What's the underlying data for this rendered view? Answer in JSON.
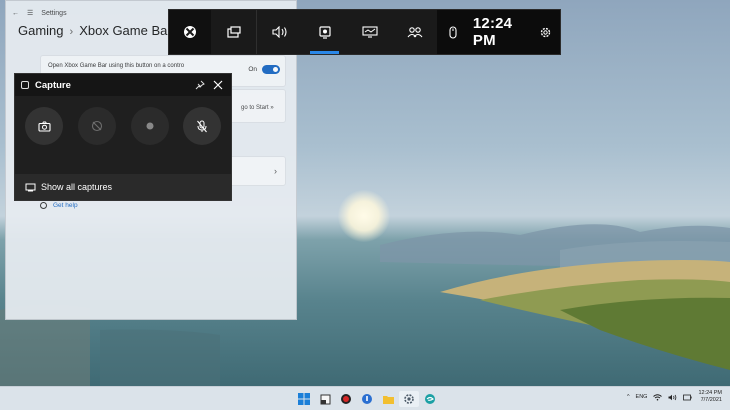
{
  "settings": {
    "title": "Settings",
    "breadcrumb_parent": "Gaming",
    "breadcrumb_current": "Xbox Game Bar",
    "open_option_text": "Open Xbox Game Bar using this button on a contro",
    "toggle_label": "On",
    "card2_text": "go to Start »",
    "help_label": "Get help"
  },
  "gamebar": {
    "time": "12:24 PM",
    "buttons": [
      {
        "icon": "xbox-icon"
      },
      {
        "icon": "widget-menu-icon"
      },
      {
        "icon": "audio-icon"
      },
      {
        "icon": "capture-icon"
      },
      {
        "icon": "performance-icon"
      },
      {
        "icon": "social-icon"
      }
    ],
    "accent": "#2b88e8"
  },
  "capture": {
    "title": "Capture",
    "show_all": "Show all captures"
  },
  "taskbar": {
    "lang": "ENG",
    "time": "12:24 PM",
    "date": "7/7/2021"
  }
}
